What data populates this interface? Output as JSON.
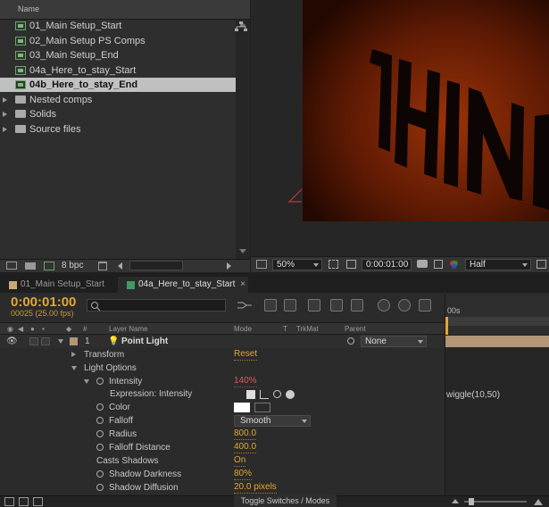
{
  "project": {
    "header_name": "Name",
    "items": [
      {
        "label": "01_Main Setup_Start",
        "type": "comp"
      },
      {
        "label": "02_Main Setup PS Comps",
        "type": "comp"
      },
      {
        "label": "03_Main Setup_End",
        "type": "comp"
      },
      {
        "label": "04a_Here_to_stay_Start",
        "type": "comp"
      },
      {
        "label": "04b_Here_to_stay_End",
        "type": "comp",
        "selected": true
      },
      {
        "label": "Nested comps",
        "type": "folder"
      },
      {
        "label": "Solids",
        "type": "folder"
      },
      {
        "label": "Source files",
        "type": "folder"
      }
    ],
    "bpc": "8 bpc"
  },
  "viewer": {
    "zoom": "50%",
    "timecode": "0:00:01:00",
    "resolution": "Half"
  },
  "timeline": {
    "tabs": [
      {
        "label": "01_Main Setup_Start",
        "color": "#c8a878",
        "active": false
      },
      {
        "label": "04a_Here_to_stay_Start",
        "color": "#3f9a63",
        "active": true
      }
    ],
    "timecode": "0:00:01:00",
    "frames": "00025 (25.00 fps)",
    "ruler_label": "00s",
    "columns": {
      "num": "#",
      "layer_name": "Layer Name",
      "mode": "Mode",
      "t": "T",
      "trkmat": "TrkMat",
      "parent": "Parent"
    },
    "layer": {
      "num": "1",
      "name": "Point Light",
      "parent": "None"
    },
    "rows": {
      "transform": "Transform",
      "reset": "Reset",
      "light_options": "Light Options",
      "intensity": "Intensity",
      "intensity_val": "140%",
      "expr_label": "Expression: Intensity",
      "expr_text": "wiggle(10,50)",
      "color": "Color",
      "falloff": "Falloff",
      "falloff_val": "Smooth",
      "radius": "Radius",
      "radius_val": "800.0",
      "falloff_distance": "Falloff Distance",
      "falloff_distance_val": "400.0",
      "casts_shadows": "Casts Shadows",
      "casts_shadows_val": "On",
      "shadow_darkness": "Shadow Darkness",
      "shadow_darkness_val": "80%",
      "shadow_diffusion": "Shadow Diffusion",
      "shadow_diffusion_val": "20.0 pixels"
    },
    "toggle_label": "Toggle Switches / Modes"
  }
}
